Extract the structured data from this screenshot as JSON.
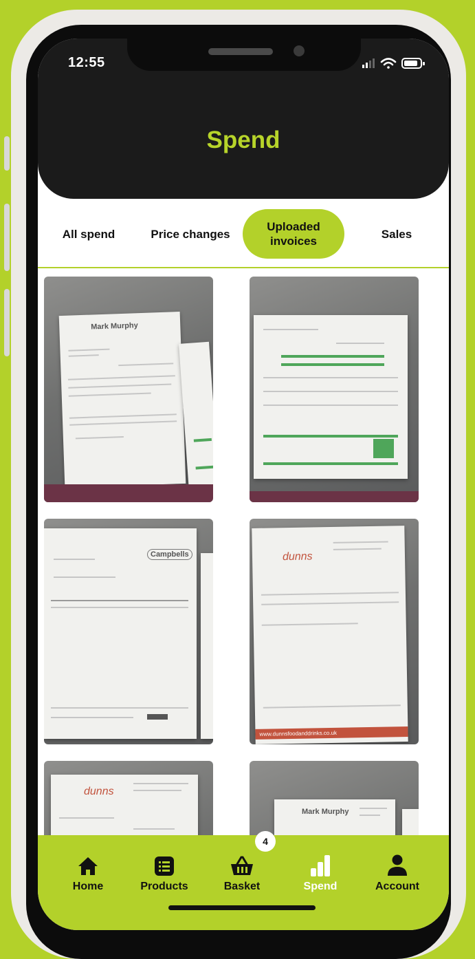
{
  "status_bar": {
    "time": "12:55"
  },
  "header": {
    "title": "Spend"
  },
  "tabs": [
    {
      "label": "All spend",
      "active": false
    },
    {
      "label": "Price changes",
      "active": false
    },
    {
      "label": "Uploaded invoices",
      "active": true
    },
    {
      "label": "Sales",
      "active": false
    }
  ],
  "invoices": {
    "thumbnails": [
      {
        "logo": "Mark Murphy"
      },
      {
        "logo": ""
      },
      {
        "logo": "Campbells"
      },
      {
        "logo": "dunns",
        "footer": "www.dunnsfoodanddrinks.co.uk"
      },
      {
        "logo": "dunns"
      },
      {
        "logo": "Mark Murphy"
      }
    ]
  },
  "bottom_nav": {
    "items": [
      {
        "label": "Home",
        "icon": "home-icon"
      },
      {
        "label": "Products",
        "icon": "list-icon"
      },
      {
        "label": "Basket",
        "icon": "basket-icon",
        "badge": "4"
      },
      {
        "label": "Spend",
        "icon": "bar-chart-icon",
        "active": true
      },
      {
        "label": "Account",
        "icon": "person-icon"
      }
    ]
  },
  "colors": {
    "accent": "#b3d12a",
    "header_bg": "#1b1b1b",
    "title": "#b7d42a"
  }
}
